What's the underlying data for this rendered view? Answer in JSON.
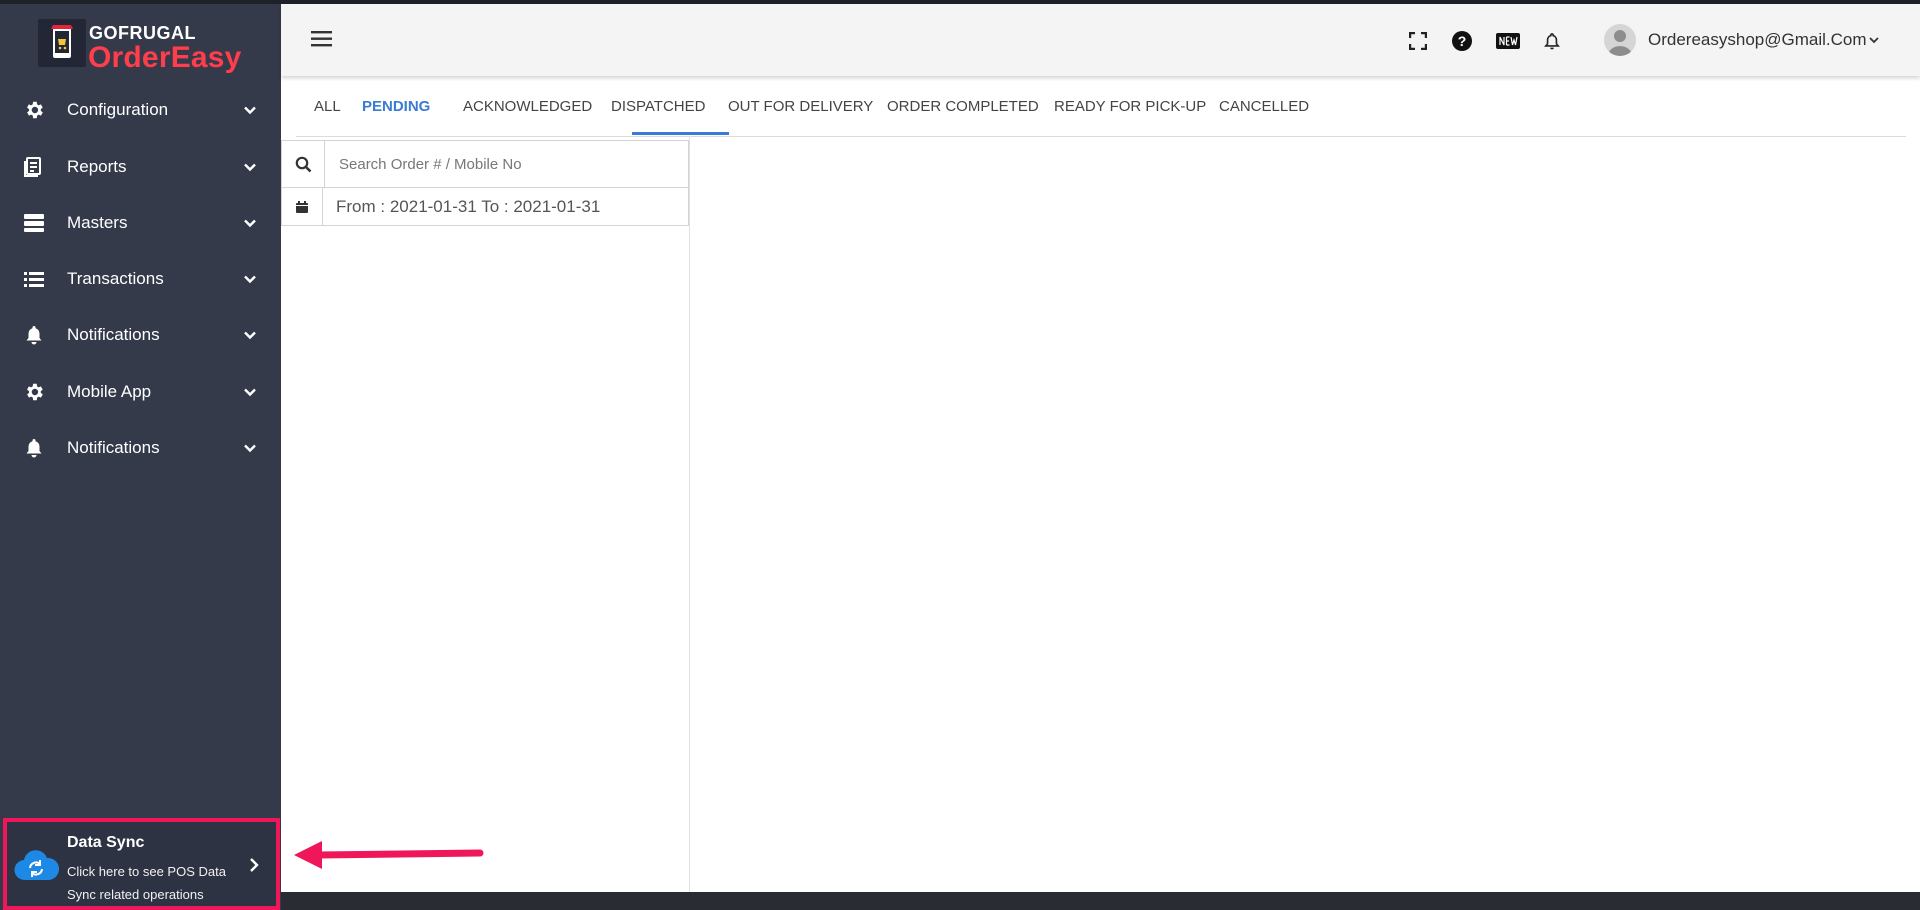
{
  "brand": {
    "top": "GOFRUGAL",
    "main": "OrderEasy"
  },
  "sidebar": {
    "items": [
      {
        "label": "Configuration",
        "icon": "gear-icon"
      },
      {
        "label": "Reports",
        "icon": "report-icon"
      },
      {
        "label": "Masters",
        "icon": "server-icon"
      },
      {
        "label": "Transactions",
        "icon": "list-icon"
      },
      {
        "label": "Notifications",
        "icon": "bell-icon"
      },
      {
        "label": "Mobile App",
        "icon": "gear-icon"
      },
      {
        "label": "Notifications",
        "icon": "bell-icon"
      }
    ],
    "datasync": {
      "title": "Data Sync",
      "subtitle": "Click here to see POS Data Sync related operations"
    }
  },
  "header": {
    "user_email": "Ordereasyshop@Gmail.Com"
  },
  "tabs": [
    {
      "label": "ALL",
      "active": false
    },
    {
      "label": "PENDING",
      "active": true
    },
    {
      "label": "ACKNOWLEDGED",
      "active": false
    },
    {
      "label": "DISPATCHED",
      "active": false
    },
    {
      "label": "OUT FOR DELIVERY",
      "active": false
    },
    {
      "label": "ORDER COMPLETED",
      "active": false
    },
    {
      "label": "READY FOR PICK-UP",
      "active": false
    },
    {
      "label": "CANCELLED",
      "active": false
    }
  ],
  "search": {
    "placeholder": "Search Order # / Mobile No",
    "value": ""
  },
  "date_range": "From : 2021-01-31 To : 2021-01-31",
  "colors": {
    "sidebar_bg": "#343a4a",
    "accent": "#3a7bd5",
    "brand_red": "#ff3d4b",
    "highlight": "#f0165a"
  }
}
